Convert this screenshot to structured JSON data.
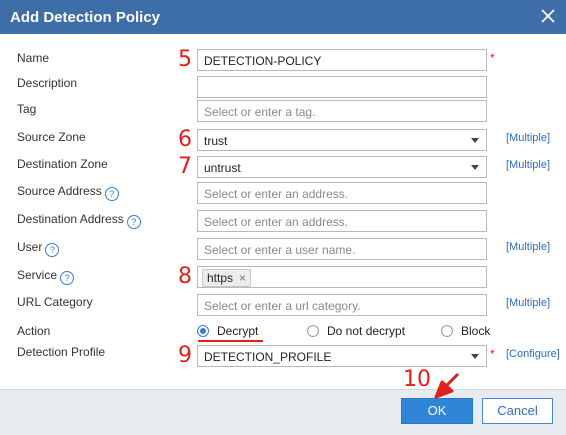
{
  "dialog": {
    "title": "Add Detection Policy"
  },
  "annotations": {
    "n5": "5",
    "n6": "6",
    "n7": "7",
    "n8": "8",
    "n9": "9",
    "n10": "10"
  },
  "fields": {
    "name": {
      "label": "Name",
      "value": "DETECTION-POLICY",
      "required": "*"
    },
    "description": {
      "label": "Description",
      "value": ""
    },
    "tag": {
      "label": "Tag",
      "placeholder": "Select or enter a tag."
    },
    "source_zone": {
      "label": "Source Zone",
      "value": "trust",
      "link": "[Multiple]"
    },
    "destination_zone": {
      "label": "Destination Zone",
      "value": "untrust",
      "link": "[Multiple]"
    },
    "source_address": {
      "label": "Source Address",
      "placeholder": "Select or enter an address."
    },
    "destination_address": {
      "label": "Destination Address",
      "placeholder": "Select or enter an address."
    },
    "user": {
      "label": "User",
      "placeholder": "Select or enter a user name.",
      "link": "[Multiple]"
    },
    "service": {
      "label": "Service",
      "token": "https",
      "token_remove": "×"
    },
    "url_category": {
      "label": "URL Category",
      "placeholder": "Select or enter a url category.",
      "link": "[Multiple]"
    },
    "action": {
      "label": "Action",
      "options": [
        "Decrypt",
        "Do not decrypt",
        "Block"
      ],
      "selected": "Decrypt"
    },
    "detection_profile": {
      "label": "Detection Profile",
      "value": "DETECTION_PROFILE",
      "required": "*",
      "link": "[Configure]"
    }
  },
  "help_glyph": "?",
  "buttons": {
    "ok": "OK",
    "cancel": "Cancel"
  },
  "colors": {
    "titlebar": "#3e6ea8",
    "accent": "#2f86d9",
    "link": "#2a6cc8",
    "annotation": "#e0201a"
  }
}
